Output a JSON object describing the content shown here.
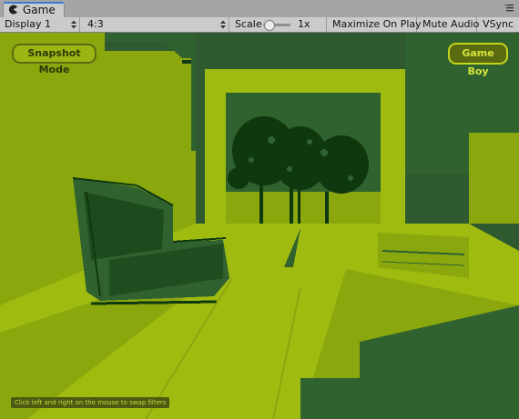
{
  "window": {
    "tab_title": "Game",
    "tab_icon": "pacman-icon",
    "menu_icon": "window-menu-icon"
  },
  "toolbar": {
    "display": "Display 1",
    "aspect": "4:3",
    "scale_label": "Scale",
    "scale_value": "1x",
    "maximize": "Maximize On Play",
    "mute": "Mute Audio",
    "vsync": "VSync"
  },
  "game": {
    "snapshot_button": "Snapshot Mode",
    "filter_button": "Game Boy",
    "hint": "Click left and right on the mouse to swap filters",
    "palette": {
      "lightest": "#9fbb0f",
      "light": "#8aa70e",
      "dark": "#306230",
      "darkest": "#0f380f"
    }
  }
}
